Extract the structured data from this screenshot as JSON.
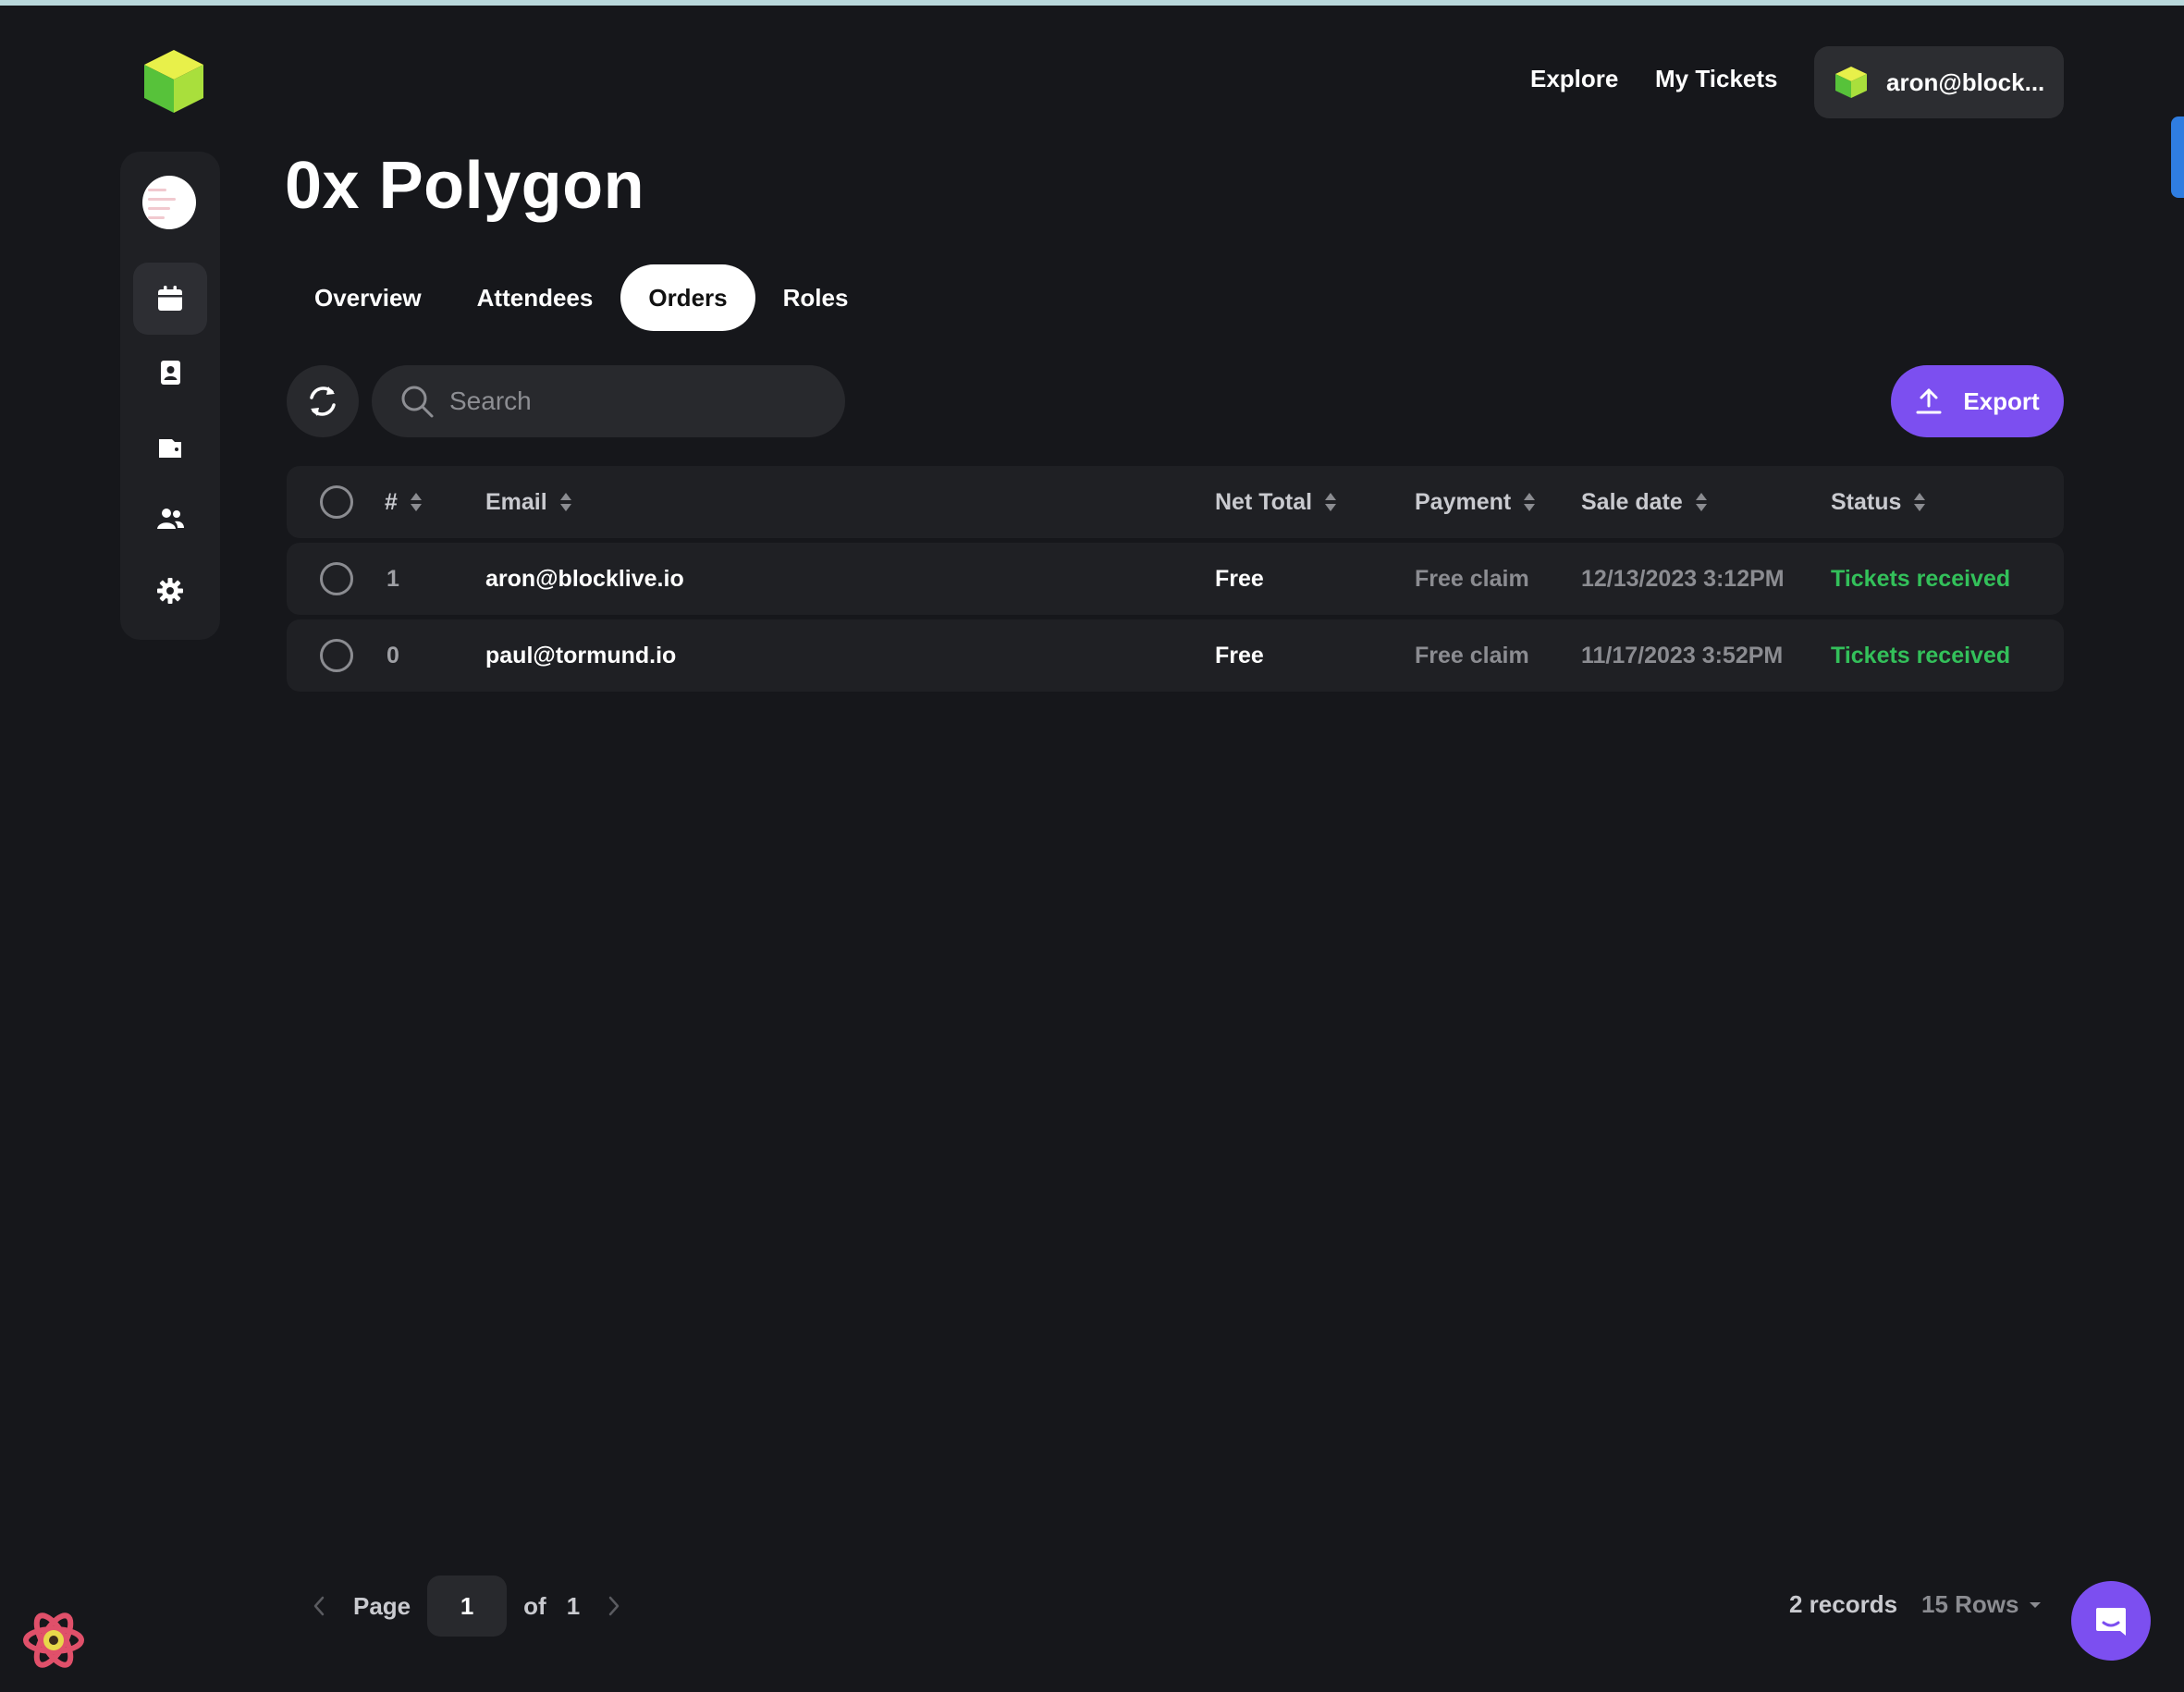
{
  "header": {
    "nav": [
      {
        "label": "Explore"
      },
      {
        "label": "My Tickets"
      }
    ],
    "user_label": "aron@block..."
  },
  "page": {
    "title": "0x Polygon",
    "tabs": [
      {
        "label": "Overview"
      },
      {
        "label": "Attendees"
      },
      {
        "label": "Orders"
      },
      {
        "label": "Roles"
      }
    ],
    "active_tab": "Orders"
  },
  "toolbar": {
    "search_placeholder": "Search",
    "export_label": "Export"
  },
  "table": {
    "columns": [
      "#",
      "Email",
      "Net Total",
      "Payment",
      "Sale date",
      "Status"
    ],
    "rows": [
      {
        "num": "1",
        "email": "aron@blocklive.io",
        "net_total": "Free",
        "payment": "Free claim",
        "sale_date": "12/13/2023 3:12PM",
        "status": "Tickets received"
      },
      {
        "num": "0",
        "email": "paul@tormund.io",
        "net_total": "Free",
        "payment": "Free claim",
        "sale_date": "11/17/2023 3:52PM",
        "status": "Tickets received"
      }
    ]
  },
  "pagination": {
    "page_label": "Page",
    "current_page": "1",
    "of_label": "of",
    "total_pages": "1",
    "records": "2 records",
    "rows_per_page": "15 Rows"
  },
  "sidebar": {
    "icons": [
      "avatar",
      "calendar-icon",
      "contact-card-icon",
      "wallet-icon",
      "users-icon",
      "gear-icon"
    ]
  },
  "colors": {
    "background": "#16171b",
    "accent": "#7c4ff0",
    "status_green": "#33c05a"
  }
}
